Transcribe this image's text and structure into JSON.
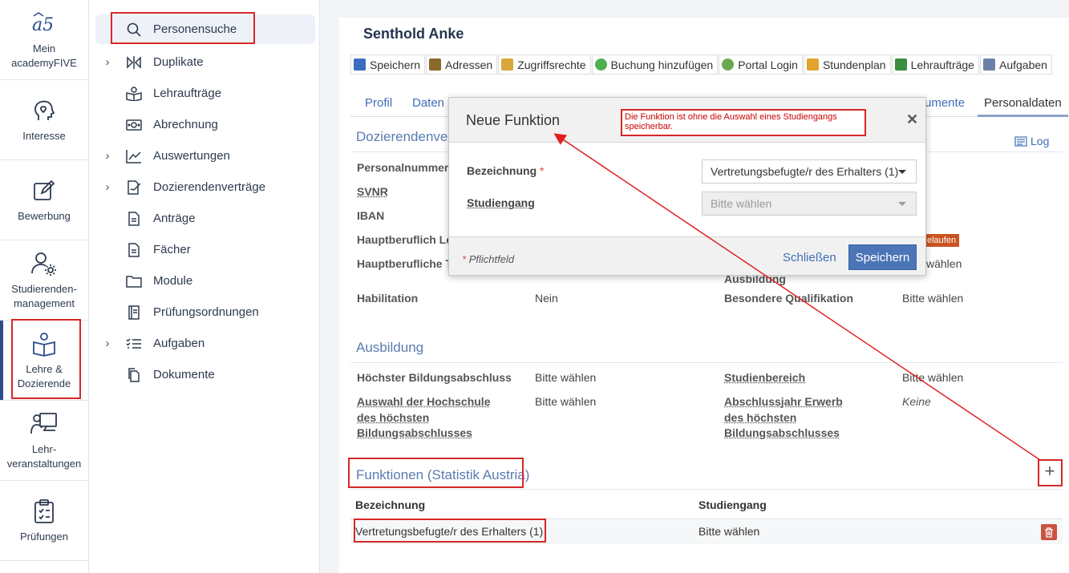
{
  "rail": {
    "items": [
      {
        "label": "Mein\nacademyFIVE",
        "icon": "academyfive-logo"
      },
      {
        "label": "Interesse",
        "icon": "head-heart-icon"
      },
      {
        "label": "Bewerbung",
        "icon": "edit-icon"
      },
      {
        "label": "Studierenden-\nmanagement",
        "icon": "user-gear-icon"
      },
      {
        "label": "Lehre &\nDozierende",
        "icon": "book-user-icon"
      },
      {
        "label": "Lehr-\nveranstaltungen",
        "icon": "presentation-icon"
      },
      {
        "label": "Prüfungen",
        "icon": "clipboard-check-icon"
      }
    ]
  },
  "subnav": {
    "items": [
      {
        "label": "Personensuche",
        "icon": "search-icon"
      },
      {
        "label": "Duplikate",
        "icon": "duplicate-icon"
      },
      {
        "label": "Lehraufträge",
        "icon": "teaching-icon"
      },
      {
        "label": "Abrechnung",
        "icon": "money-icon"
      },
      {
        "label": "Auswertungen",
        "icon": "chart-icon"
      },
      {
        "label": "Dozierendenverträge",
        "icon": "contract-icon"
      },
      {
        "label": "Anträge",
        "icon": "document-icon"
      },
      {
        "label": "Fächer",
        "icon": "file-icon"
      },
      {
        "label": "Module",
        "icon": "folder-icon"
      },
      {
        "label": "Prüfungsordnungen",
        "icon": "book-icon"
      },
      {
        "label": "Aufgaben",
        "icon": "checklist-icon"
      },
      {
        "label": "Dokumente",
        "icon": "documents-icon"
      }
    ]
  },
  "main": {
    "person_name": "Senthold Anke",
    "toolbar": [
      {
        "label": "Speichern",
        "icon": "save-icon",
        "color": "#3b6cc0"
      },
      {
        "label": "Adressen",
        "icon": "address-book-icon",
        "color": "#8a6a2b"
      },
      {
        "label": "Zugriffsrechte",
        "icon": "lock-icon",
        "color": "#d8a93a"
      },
      {
        "label": "Buchung hinzufügen",
        "icon": "add-circle-icon",
        "color": "#4caf50"
      },
      {
        "label": "Portal Login",
        "icon": "globe-icon",
        "color": "#6aa84f"
      },
      {
        "label": "Stundenplan",
        "icon": "calendar-icon",
        "color": "#e0a32e"
      },
      {
        "label": "Lehraufträge",
        "icon": "teaching-icon",
        "color": "#3c8d40"
      },
      {
        "label": "Aufgaben",
        "icon": "tasks-icon",
        "color": "#6b7fa8"
      }
    ],
    "tabs": {
      "profil": "Profil",
      "daten": "Daten",
      "dokumente": "umente",
      "personaldaten": "Personaldaten"
    },
    "log_label": "Log",
    "doz_section": {
      "title": "Dozierendenvert",
      "personalnummer": "Personalnummer",
      "svnr": "SVNR",
      "iban": "IBAN",
      "hauptberuflich_lehre": "Hauptberuflich Leh",
      "hauptberufliche_taetigkeit": "Hauptberufliche Tä",
      "badge": "elaufen",
      "hauptberuf_value": "wählen",
      "ausbildung_label": "Ausbildung",
      "habilitation_label": "Habilitation",
      "habilitation_value": "Nein",
      "besondere_label": "Besondere Qualifikation",
      "besondere_value": "Bitte wählen"
    },
    "ausbildung": {
      "title": "Ausbildung",
      "hoechster_label": "Höchster Bildungsabschluss",
      "hoechster_value": "Bitte wählen",
      "studienbereich_label": "Studienbereich",
      "studienbereich_value": "Bitte wählen",
      "hochschule_label": "Auswahl der Hochschule des höchsten Bildungsabschlusses",
      "hochschule_value": "Bitte wählen",
      "abschlussjahr_label": "Abschlussjahr Erwerb des höchsten Bildungsabschlusses",
      "abschlussjahr_value": "Keine"
    },
    "funktionen": {
      "title": "Funktionen (Statistik Austria)",
      "col_bezeichnung": "Bezeichnung",
      "col_studiengang": "Studiengang",
      "rows": [
        {
          "bezeichnung": "Vertretungsbefugte/r des Erhalters (1)",
          "studiengang": "Bitte wählen"
        }
      ]
    }
  },
  "modal": {
    "title": "Neue Funktion",
    "note": "Die Funktion ist ohne die Auswahl eines Studiengangs speicherbar.",
    "bezeichnung_label": "Bezeichnung",
    "bezeichnung_value": "Vertretungsbefugte/r des Erhalters (1)",
    "studiengang_label": "Studiengang",
    "studiengang_placeholder": "Bitte wählen",
    "required_star": "*",
    "required_text": "Pflichtfeld",
    "close_label": "Schließen",
    "save_label": "Speichern"
  },
  "colors": {
    "accent": "#3f6fb5",
    "primary_button": "#4c75b8",
    "annotation_red": "#d62727"
  }
}
